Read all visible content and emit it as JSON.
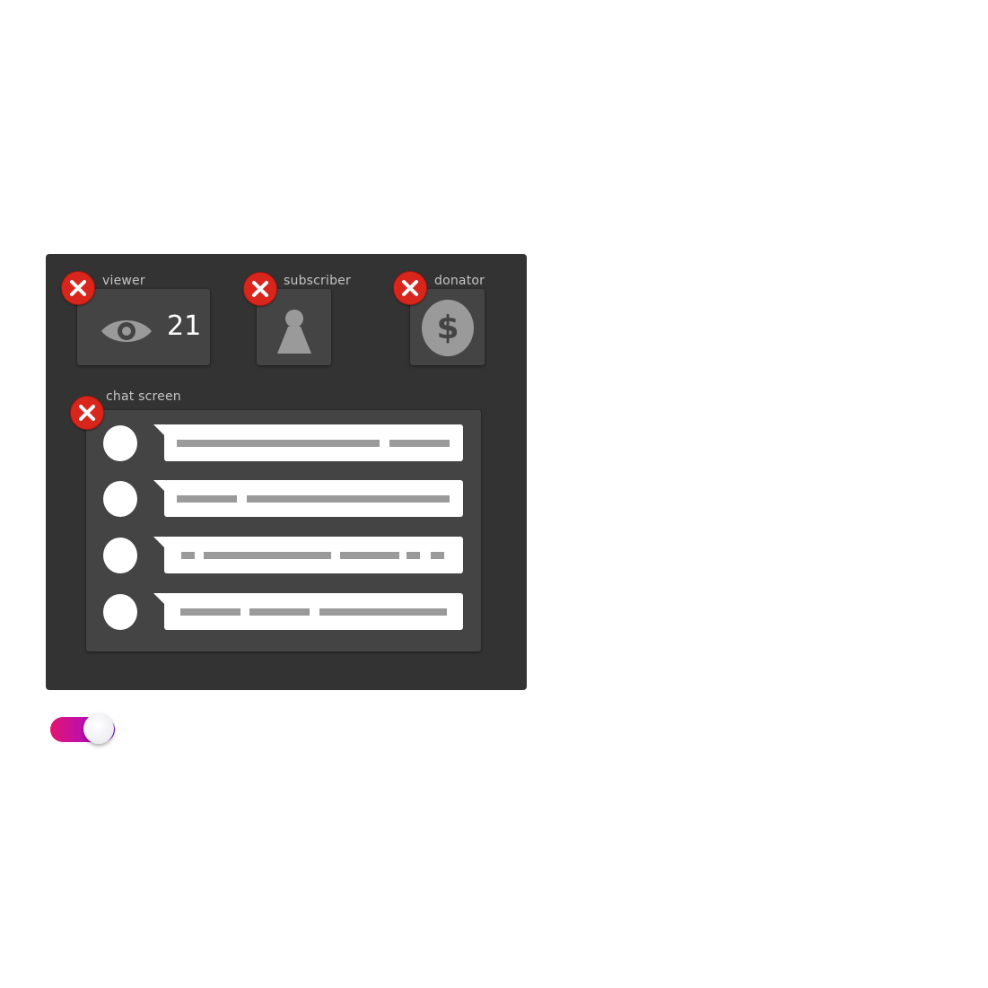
{
  "widgets": {
    "viewer": {
      "label": "viewer",
      "count": "21"
    },
    "subscriber": {
      "label": "subscriber"
    },
    "donator": {
      "label": "donator",
      "symbol": "$"
    },
    "chat": {
      "label": "chat screen"
    }
  },
  "toggle": {
    "state": "on"
  },
  "icons": [
    "close-icon",
    "eye-icon",
    "person-icon",
    "dollar-coin-icon"
  ],
  "colors": {
    "panel": "#333333",
    "card": "#444444",
    "close_button": "#d9261c",
    "toggle_start": "#e4146f",
    "toggle_end": "#7a16c9"
  }
}
